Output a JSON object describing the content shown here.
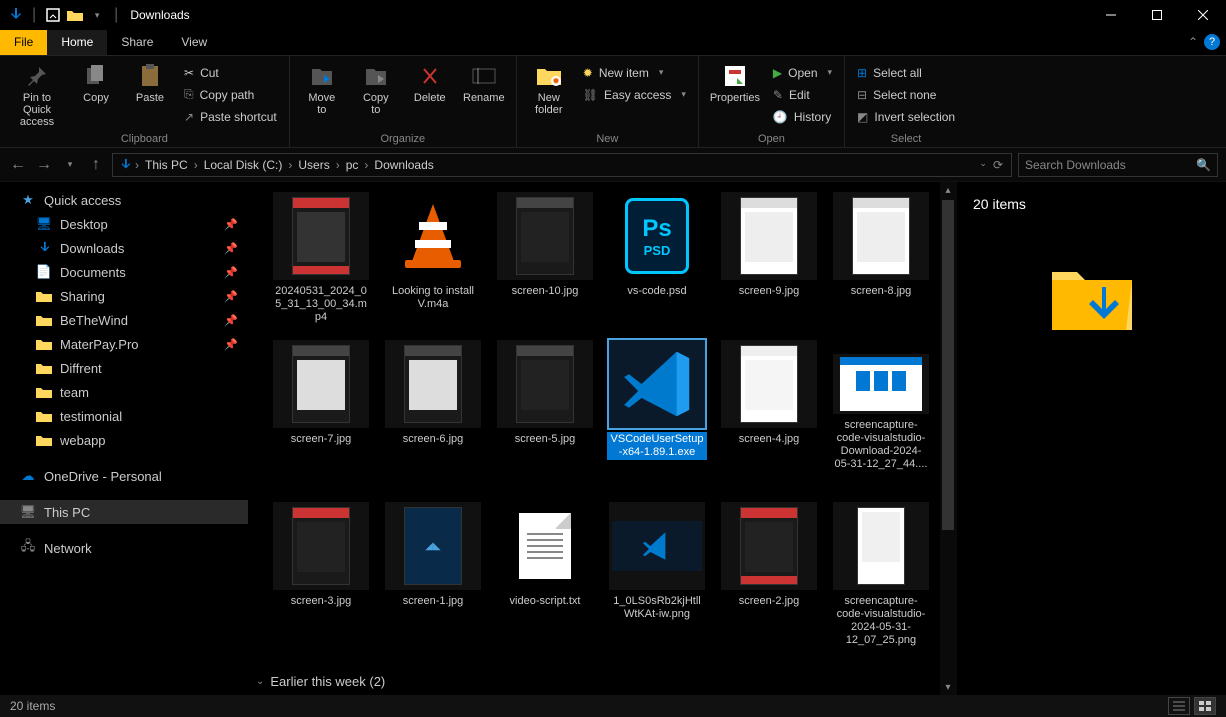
{
  "window": {
    "title": "Downloads"
  },
  "tabs": {
    "file": "File",
    "home": "Home",
    "share": "Share",
    "view": "View"
  },
  "ribbon": {
    "pin_quick": "Pin to Quick\naccess",
    "copy": "Copy",
    "paste": "Paste",
    "cut": "Cut",
    "copy_path": "Copy path",
    "paste_shortcut": "Paste shortcut",
    "clipboard_label": "Clipboard",
    "move_to": "Move\nto",
    "copy_to": "Copy\nto",
    "delete": "Delete",
    "rename": "Rename",
    "organize_label": "Organize",
    "new_folder": "New\nfolder",
    "new_item": "New item",
    "easy_access": "Easy access",
    "new_label": "New",
    "properties": "Properties",
    "open": "Open",
    "edit": "Edit",
    "history": "History",
    "open_label": "Open",
    "select_all": "Select all",
    "select_none": "Select none",
    "invert_selection": "Invert selection",
    "select_label": "Select"
  },
  "breadcrumb": {
    "items": [
      "This PC",
      "Local Disk (C:)",
      "Users",
      "pc",
      "Downloads"
    ]
  },
  "search": {
    "placeholder": "Search Downloads"
  },
  "sidebar": {
    "quick_access": "Quick access",
    "desktop": "Desktop",
    "downloads": "Downloads",
    "documents": "Documents",
    "sharing": "Sharing",
    "bethewind": "BeTheWind",
    "materpay": "MaterPay.Pro",
    "diffrent": "Diffrent",
    "team": "team",
    "testimonial": "testimonial",
    "webapp": "webapp",
    "onedrive": "OneDrive - Personal",
    "thispc": "This PC",
    "network": "Network"
  },
  "files": {
    "r1": [
      "20240531_2024_05_31_13_00_34.mp4",
      "Looking to install V.m4a",
      "screen-10.jpg",
      "vs-code.psd",
      "screen-9.jpg",
      "screen-8.jpg"
    ],
    "r2": [
      "screen-7.jpg",
      "screen-6.jpg",
      "screen-5.jpg",
      "VSCodeUserSetup-x64-1.89.1.exe",
      "screen-4.jpg",
      "screencapture-code-visualstudio-Download-2024-05-31-12_27_44...."
    ],
    "r3": [
      "screen-3.jpg",
      "screen-1.jpg",
      "video-script.txt",
      "1_0LS0sRb2kjHtllWtKAt-iw.png",
      "screen-2.jpg",
      "screencapture-code-visualstudio-2024-05-31-12_07_25.png"
    ]
  },
  "section_earlier": "Earlier this week (2)",
  "details": {
    "count": "20 items"
  },
  "statusbar": {
    "count": "20 items"
  }
}
